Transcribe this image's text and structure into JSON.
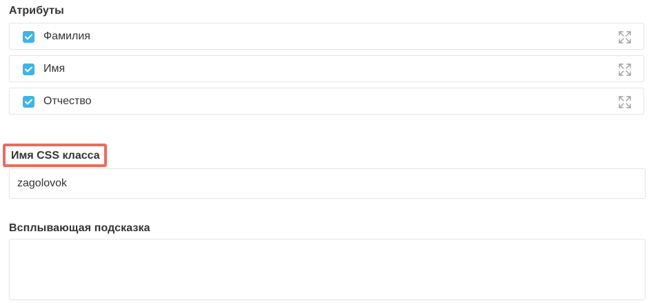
{
  "attributes": {
    "title": "Атрибуты",
    "items": [
      {
        "label": "Фамилия",
        "checked": true
      },
      {
        "label": "Имя",
        "checked": true
      },
      {
        "label": "Отчество",
        "checked": true
      }
    ]
  },
  "css_class": {
    "label": "Имя CSS класса",
    "value": "zagolovok"
  },
  "tooltip": {
    "label": "Всплывающая подсказка",
    "value": ""
  },
  "colors": {
    "checkbox": "#3fb4e5",
    "highlight_border": "#ec6b5e",
    "input_border": "#e3e5e8"
  },
  "icons": [
    "check-icon",
    "expand-icon"
  ]
}
